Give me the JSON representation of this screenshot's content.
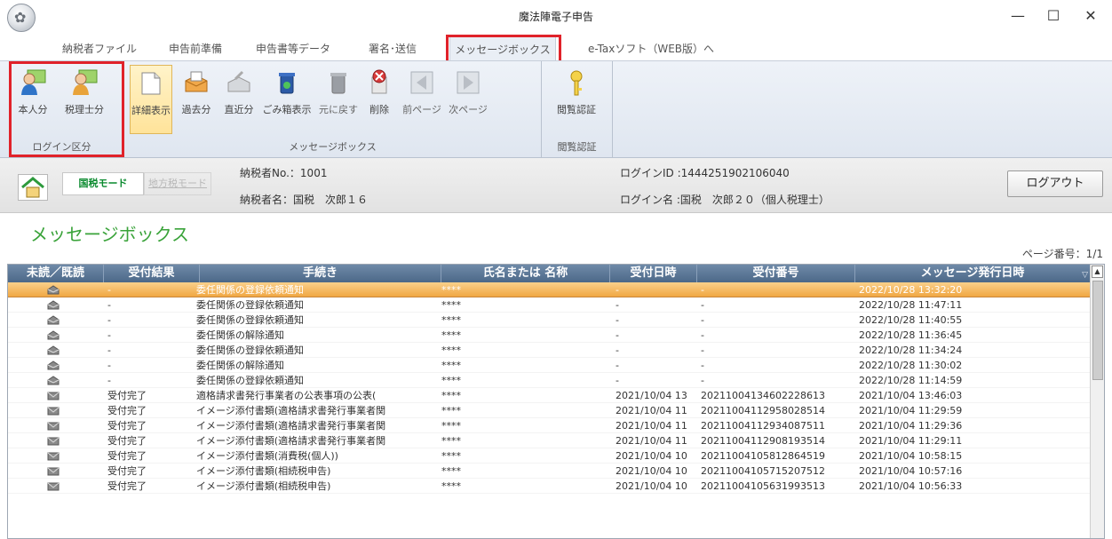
{
  "window": {
    "title": "魔法陣電子申告",
    "minimize": "—",
    "maximize": "☐",
    "close": "✕"
  },
  "menu": {
    "tabs": [
      "納税者ファイル",
      "申告前準備",
      "申告書等データ",
      "署名･送信",
      "メッセージボックス",
      "e-Taxソフト（WEB版）へ"
    ],
    "active_index": 4
  },
  "ribbon": {
    "login_group": {
      "label": "ログイン区分",
      "buttons": [
        "本人分",
        "税理士分"
      ]
    },
    "msgbox_group": {
      "label": "メッセージボックス",
      "buttons": [
        "詳細表示",
        "過去分",
        "直近分",
        "ごみ箱表示",
        "元に戻す",
        "削除",
        "前ページ",
        "次ページ"
      ]
    },
    "auth_group": {
      "label": "閲覧認証",
      "buttons": [
        "閲覧認証"
      ]
    }
  },
  "info": {
    "mode_national": "国税モード",
    "mode_local": "地方税モード",
    "taxpayer_no": "納税者No.：1001",
    "taxpayer_name": "納税者名：国税　次郎１６",
    "login_id": "ログインID :1444251902106040",
    "login_name": "ログイン名 :国税　次郎２０（個人税理士）",
    "logout": "ログアウト"
  },
  "message_box": {
    "title": "メッセージボックス",
    "page_number": "ページ番号：1/1",
    "columns": [
      "未読／既読",
      "受付結果",
      "手続き",
      "氏名または 名称",
      "受付日時",
      "受付番号",
      "メッセージ発行日時"
    ],
    "sort_indicator": "▽",
    "rows": [
      {
        "status": "-",
        "procedure": "委任関係の登録依頼通知",
        "name": "****",
        "date": "-",
        "number": "-",
        "issued": "2022/10/28 13:32:20",
        "icon": "open",
        "selected": true
      },
      {
        "status": "-",
        "procedure": "委任関係の登録依頼通知",
        "name": "****",
        "date": "-",
        "number": "-",
        "issued": "2022/10/28 11:47:11",
        "icon": "open"
      },
      {
        "status": "-",
        "procedure": "委任関係の登録依頼通知",
        "name": "****",
        "date": "-",
        "number": "-",
        "issued": "2022/10/28 11:40:55",
        "icon": "open"
      },
      {
        "status": "-",
        "procedure": "委任関係の解除通知",
        "name": "****",
        "date": "-",
        "number": "-",
        "issued": "2022/10/28 11:36:45",
        "icon": "open"
      },
      {
        "status": "-",
        "procedure": "委任関係の登録依頼通知",
        "name": "****",
        "date": "-",
        "number": "-",
        "issued": "2022/10/28 11:34:24",
        "icon": "open"
      },
      {
        "status": "-",
        "procedure": "委任関係の解除通知",
        "name": "****",
        "date": "-",
        "number": "-",
        "issued": "2022/10/28 11:30:02",
        "icon": "open"
      },
      {
        "status": "-",
        "procedure": "委任関係の登録依頼通知",
        "name": "****",
        "date": "-",
        "number": "-",
        "issued": "2022/10/28 11:14:59",
        "icon": "open"
      },
      {
        "status": "受付完了",
        "procedure": "適格請求書発行事業者の公表事項の公表(",
        "name": "****",
        "date": "2021/10/04 13",
        "number": "20211004134602228613",
        "issued": "2021/10/04 13:46:03",
        "icon": "closed"
      },
      {
        "status": "受付完了",
        "procedure": "イメージ添付書類(適格請求書発行事業者関",
        "name": "****",
        "date": "2021/10/04 11",
        "number": "20211004112958028514",
        "issued": "2021/10/04 11:29:59",
        "icon": "closed"
      },
      {
        "status": "受付完了",
        "procedure": "イメージ添付書類(適格請求書発行事業者関",
        "name": "****",
        "date": "2021/10/04 11",
        "number": "20211004112934087511",
        "issued": "2021/10/04 11:29:36",
        "icon": "closed"
      },
      {
        "status": "受付完了",
        "procedure": "イメージ添付書類(適格請求書発行事業者関",
        "name": "****",
        "date": "2021/10/04 11",
        "number": "20211004112908193514",
        "issued": "2021/10/04 11:29:11",
        "icon": "closed"
      },
      {
        "status": "受付完了",
        "procedure": "イメージ添付書類(消費税(個人))",
        "name": "****",
        "date": "2021/10/04 10",
        "number": "20211004105812864519",
        "issued": "2021/10/04 10:58:15",
        "icon": "closed"
      },
      {
        "status": "受付完了",
        "procedure": "イメージ添付書類(相続税申告)",
        "name": "****",
        "date": "2021/10/04 10",
        "number": "20211004105715207512",
        "issued": "2021/10/04 10:57:16",
        "icon": "closed"
      },
      {
        "status": "受付完了",
        "procedure": "イメージ添付書類(相続税申告)",
        "name": "****",
        "date": "2021/10/04 10",
        "number": "20211004105631993513",
        "issued": "2021/10/04 10:56:33",
        "icon": "closed"
      }
    ]
  }
}
